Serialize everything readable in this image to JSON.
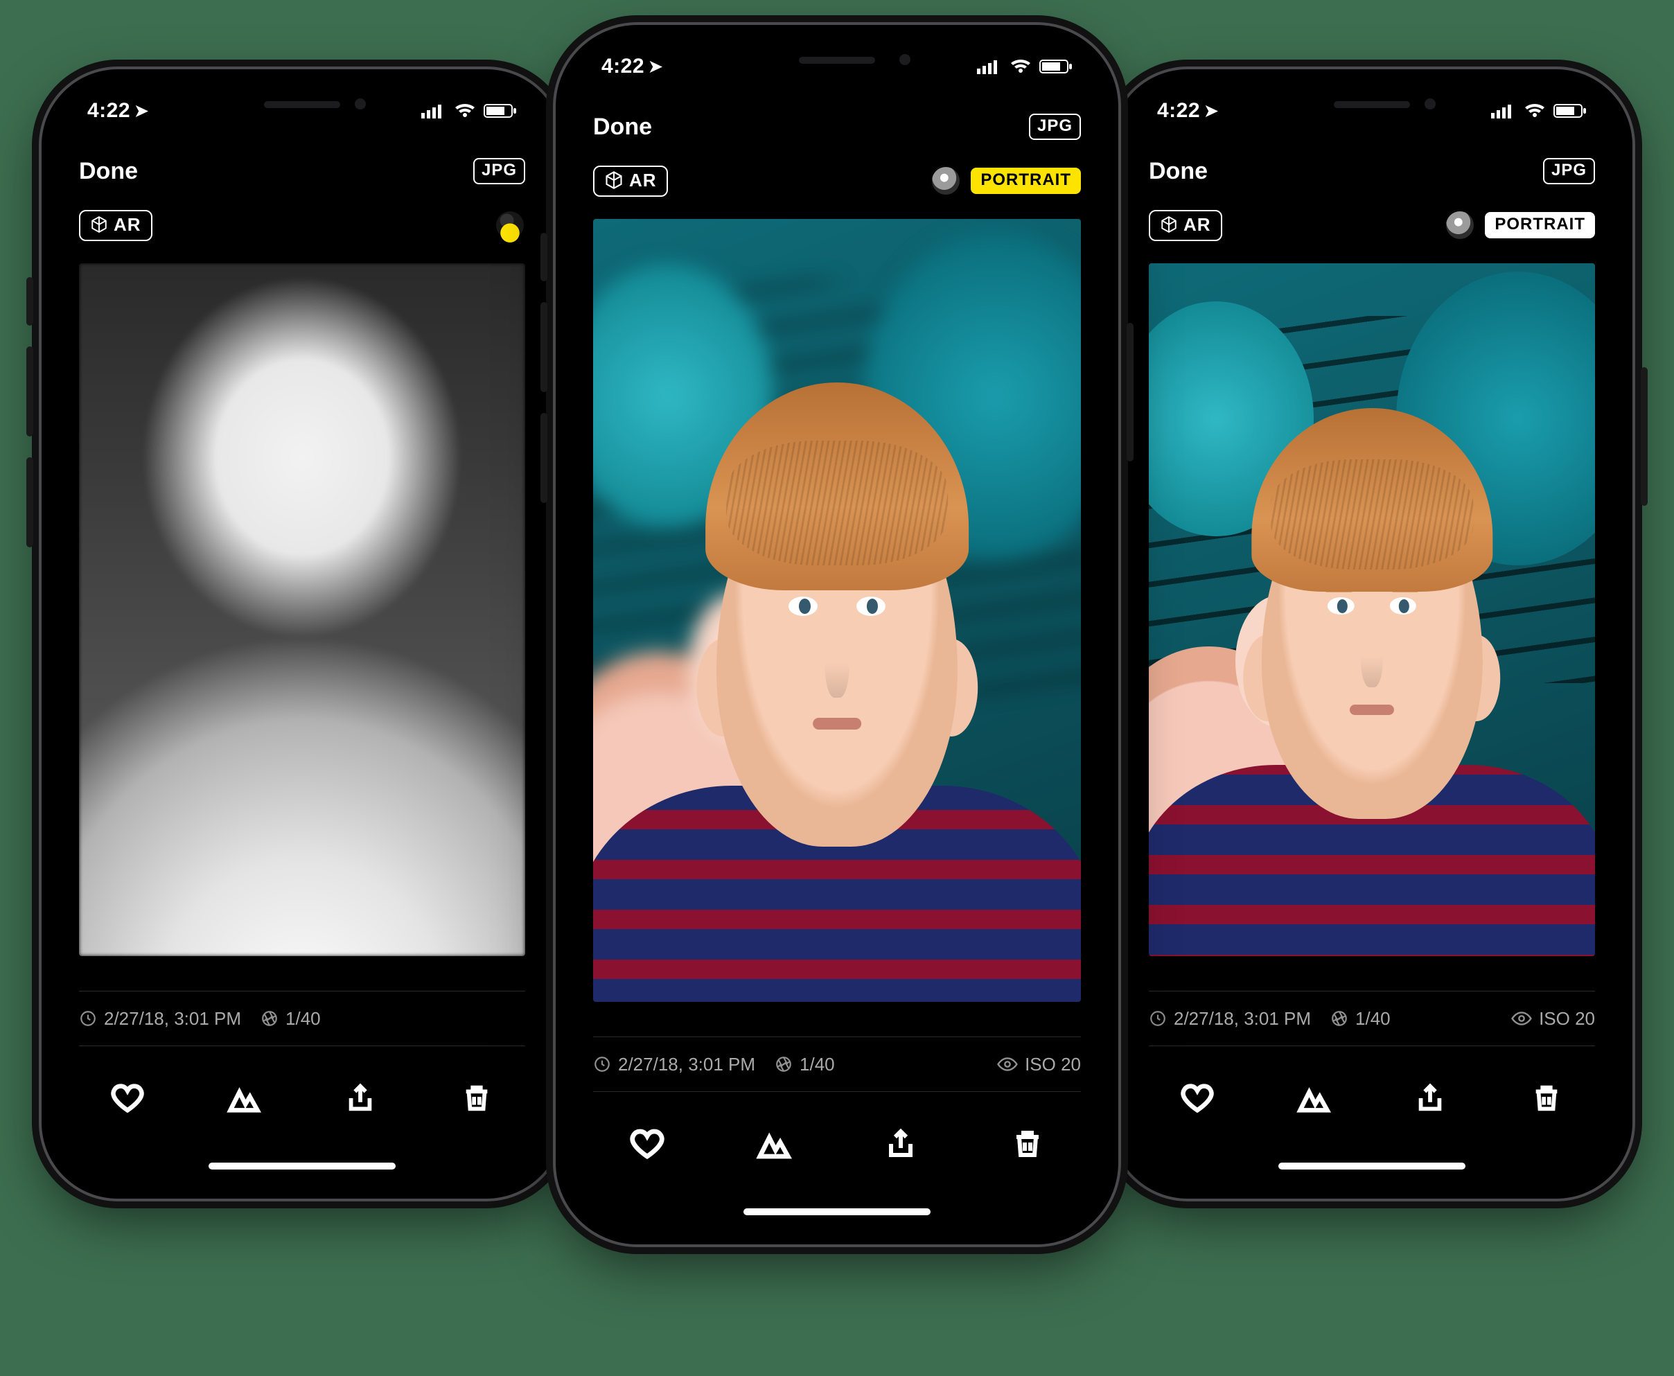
{
  "status": {
    "time": "4:22",
    "location_on": true
  },
  "nav": {
    "done": "Done",
    "format": "JPG"
  },
  "toolbar": {
    "ar": "AR",
    "portrait": "PORTRAIT"
  },
  "meta": {
    "datetime": "2/27/18, 3:01 PM",
    "exposure": "1/40",
    "iso": "ISO 20"
  },
  "phones": {
    "left": {
      "mode": "depth",
      "portrait_badge": null,
      "show_iso": false,
      "depth_active": true
    },
    "center": {
      "mode": "portrait",
      "portrait_badge": "yellow",
      "show_iso": true,
      "depth_active": false
    },
    "right": {
      "mode": "original",
      "portrait_badge": "white",
      "show_iso": true,
      "depth_active": false
    }
  }
}
